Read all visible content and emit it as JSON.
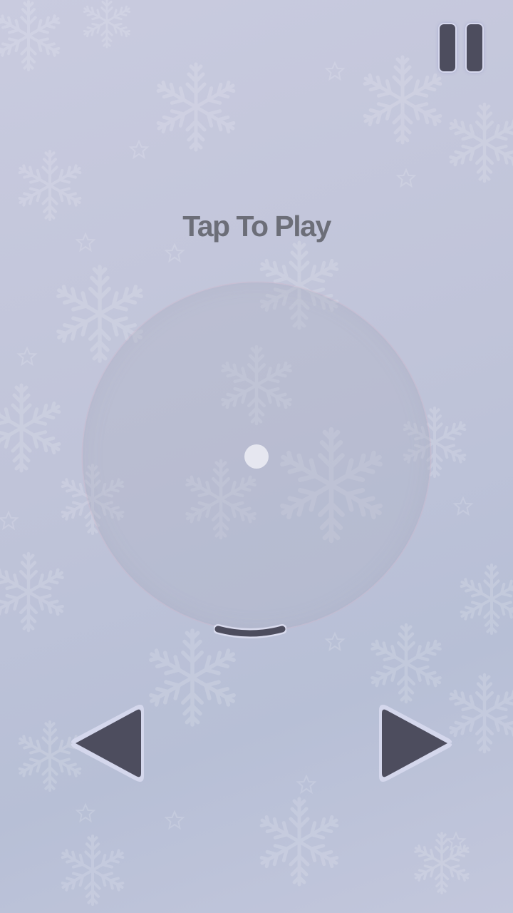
{
  "screen": {
    "prompt_text": "Tap To Play"
  },
  "controls": {
    "pause_icon": "pause-icon",
    "left_icon": "triangle-left-icon",
    "right_icon": "triangle-right-icon"
  },
  "colors": {
    "background": "#c0c4d9",
    "text": "#6c6e78",
    "controls": "#4d4d5e",
    "ball": "#e6e7f0"
  }
}
